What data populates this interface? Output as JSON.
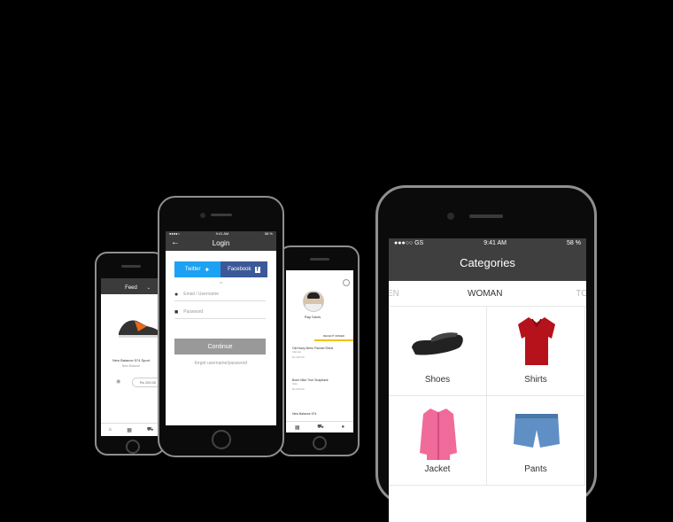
{
  "feed_phone": {
    "title": "Feed",
    "product_name": "New Balance 574 Sport",
    "product_brand": "New Balance",
    "price": "Rs 200.00"
  },
  "login_phone": {
    "status_time": "9:41 AM",
    "status_battery": "58 %",
    "title": "Login",
    "twitter_label": "Twitter",
    "facebook_label": "Facebook",
    "or_label": "or",
    "email_placeholder": "Email / Username",
    "password_placeholder": "Password",
    "continue_label": "Continue",
    "forgot_label": "forgot username/password"
  },
  "profile_phone": {
    "name": "Ray Davis",
    "tab_label": "RECENT ORDER",
    "items": [
      {
        "title": "Old Navy Mens Flannel Shirts",
        "sub": "Flannel",
        "price": "Rs 200.00"
      },
      {
        "title": "Bone Nike True Snapback",
        "sub": "Nike",
        "price": "Rs 300.00"
      },
      {
        "title": "New Balance 574"
      }
    ]
  },
  "categories_phone": {
    "status_carrier": "GS",
    "status_time": "9:41 AM",
    "status_battery": "58 %",
    "title": "Categories",
    "tabs": [
      "EN",
      "WOMAN",
      "TO"
    ],
    "categories": [
      {
        "label": "Shoes"
      },
      {
        "label": "Shirts"
      },
      {
        "label": "Jacket"
      },
      {
        "label": "Pants"
      }
    ]
  },
  "colors": {
    "twitter": "#1da1f2",
    "facebook": "#3b5998",
    "header_dark": "#3b3b3b",
    "accent_yellow": "#f2c200"
  }
}
